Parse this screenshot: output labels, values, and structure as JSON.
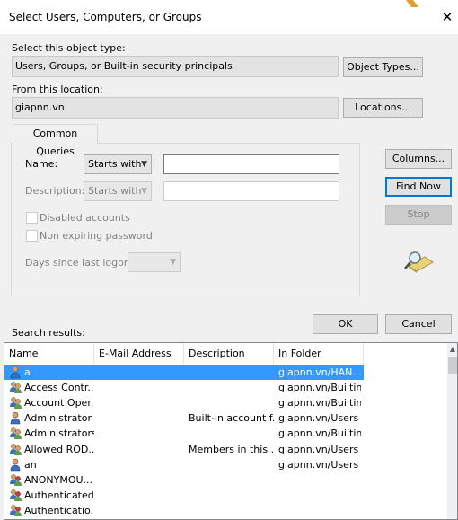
{
  "window": {
    "title": "Select Users, Computers, or Groups"
  },
  "object_type": {
    "label": "Select this object type:",
    "value": "Users, Groups, or Built-in security principals",
    "button": "Object Types..."
  },
  "location": {
    "label": "From this location:",
    "value": "giapnn.vn",
    "button": "Locations..."
  },
  "queries": {
    "tab": "Common Queries",
    "name_label": "Name:",
    "name_mode": "Starts with",
    "name_value": "",
    "description_label": "Description:",
    "description_mode": "Starts with",
    "description_value": "",
    "disabled_accounts": "Disabled accounts",
    "non_expiring": "Non expiring password",
    "days_label": "Days since last logon:",
    "days_value": ""
  },
  "side_buttons": {
    "columns": "Columns...",
    "find_now": "Find Now",
    "stop": "Stop"
  },
  "dialog_buttons": {
    "ok": "OK",
    "cancel": "Cancel"
  },
  "results": {
    "label": "Search results:",
    "columns": [
      "Name",
      "E-Mail Address",
      "Description",
      "In Folder"
    ],
    "rows": [
      {
        "icon": "user-icon",
        "name": "a",
        "email": "",
        "description": "",
        "folder": "giapnn.vn/HAN...",
        "selected": true
      },
      {
        "icon": "group-icon",
        "name": "Access Contr...",
        "email": "",
        "description": "",
        "folder": "giapnn.vn/Builtin"
      },
      {
        "icon": "group-icon",
        "name": "Account Oper...",
        "email": "",
        "description": "",
        "folder": "giapnn.vn/Builtin"
      },
      {
        "icon": "user-icon",
        "name": "Administrator",
        "email": "",
        "description": "Built-in account f...",
        "folder": "giapnn.vn/Users"
      },
      {
        "icon": "group-icon",
        "name": "Administrators",
        "email": "",
        "description": "",
        "folder": "giapnn.vn/Builtin"
      },
      {
        "icon": "group-icon",
        "name": "Allowed ROD...",
        "email": "",
        "description": "Members in this ...",
        "folder": "giapnn.vn/Users"
      },
      {
        "icon": "user-icon",
        "name": "an",
        "email": "",
        "description": "",
        "folder": "giapnn.vn/Users"
      },
      {
        "icon": "principal-icon",
        "name": "ANONYMOU...",
        "email": "",
        "description": "",
        "folder": ""
      },
      {
        "icon": "principal-icon",
        "name": "Authenticated...",
        "email": "",
        "description": "",
        "folder": ""
      },
      {
        "icon": "principal-icon",
        "name": "Authenticatio...",
        "email": "",
        "description": "",
        "folder": ""
      }
    ]
  },
  "colors": {
    "selection": "#3399ff",
    "dialog_bg": "#f0f0f0",
    "default_button_border": "#0078d7"
  }
}
